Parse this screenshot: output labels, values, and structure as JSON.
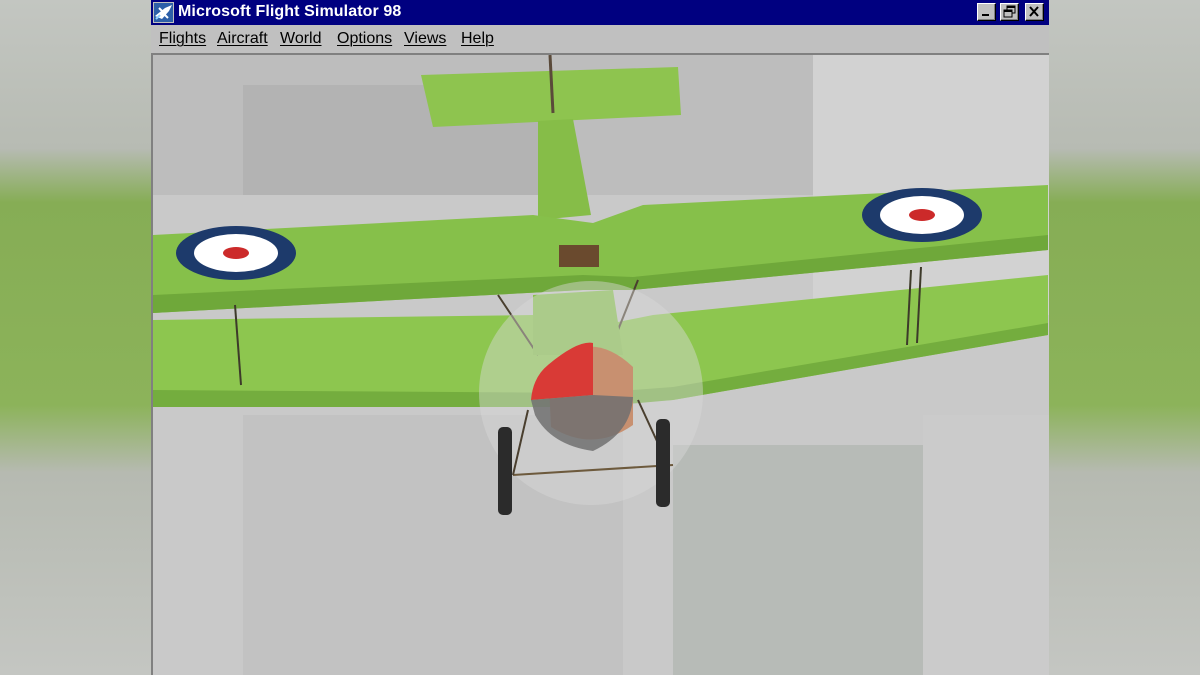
{
  "window": {
    "title": "Microsoft Flight Simulator 98",
    "controls": {
      "minimize": "minimize-icon",
      "maximize": "restore-icon",
      "close": "close-icon"
    }
  },
  "menu": {
    "items": [
      {
        "label": "Flights"
      },
      {
        "label": "Aircraft"
      },
      {
        "label": "World"
      },
      {
        "label": "Options"
      },
      {
        "label": "Views"
      },
      {
        "label": "Help"
      }
    ]
  },
  "viewport": {
    "subject": "green biplane with roundel markings",
    "colors": {
      "aircraft": "#8cc24a",
      "sky": "#c8c8c8",
      "roundel_outer": "#1d3a6b",
      "roundel_mid": "#ffffff",
      "roundel_center": "#cc2a2a",
      "titlebar": "#000080",
      "chrome": "#c0c0c0"
    }
  }
}
